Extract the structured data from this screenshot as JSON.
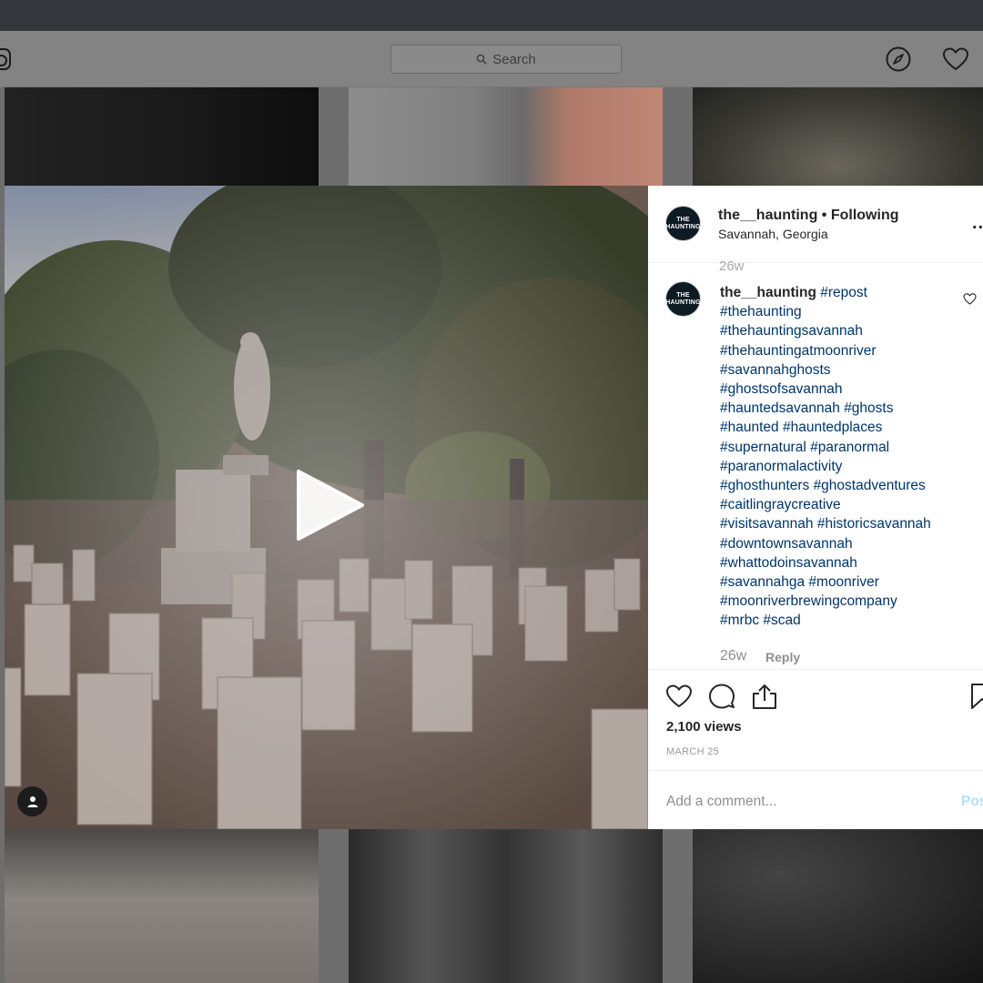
{
  "header": {
    "search_placeholder": "Search"
  },
  "post": {
    "username": "the__haunting",
    "separator": " • ",
    "follow_status": "Following",
    "location": "Savannah, Georgia",
    "more": "...",
    "avatar_text": "THE HAUNTING",
    "scrolled_time": "26w"
  },
  "caption": {
    "username": "the__haunting",
    "lines": [
      [
        "#repost"
      ],
      [
        "#thehaunting"
      ],
      [
        "#thehauntingsavannah"
      ],
      [
        "#thehauntingatmoonriver"
      ],
      [
        "#savannahghosts"
      ],
      [
        "#ghostsofsavannah"
      ],
      [
        "#hauntedsavannah",
        "#ghosts"
      ],
      [
        "#haunted",
        "#hauntedplaces"
      ],
      [
        "#supernatural",
        "#paranormal"
      ],
      [
        "#paranormalactivity"
      ],
      [
        "#ghosthunters",
        "#ghostadventures"
      ],
      [
        "#caitlingraycreative"
      ],
      [
        "#visitsavannah",
        "#historicsavannah"
      ],
      [
        "#downtownsavannah"
      ],
      [
        "#whattodoinsavannah"
      ],
      [
        "#savannahga",
        "#moonriver"
      ],
      [
        "#moonriverbrewingcompany"
      ],
      [
        "#mrbc",
        "#scad"
      ]
    ],
    "time": "26w",
    "reply_label": "Reply"
  },
  "stats": {
    "views": "2,100 views",
    "date": "MARCH 25"
  },
  "comment_box": {
    "placeholder": "Add a comment...",
    "post_label": "Post"
  },
  "icons": {
    "logo": "instagram-logo-icon",
    "search": "search-icon",
    "explore": "compass-icon",
    "activity": "heart-icon",
    "play": "play-icon",
    "user_tag": "person-icon",
    "like": "heart-icon",
    "comment": "speech-bubble-icon",
    "share": "share-icon",
    "save": "bookmark-icon",
    "caption_like": "small-heart-icon"
  },
  "colors": {
    "hashtag": "#003569",
    "post_button": "#b2dffc",
    "overlay": "#6e6e6e"
  }
}
